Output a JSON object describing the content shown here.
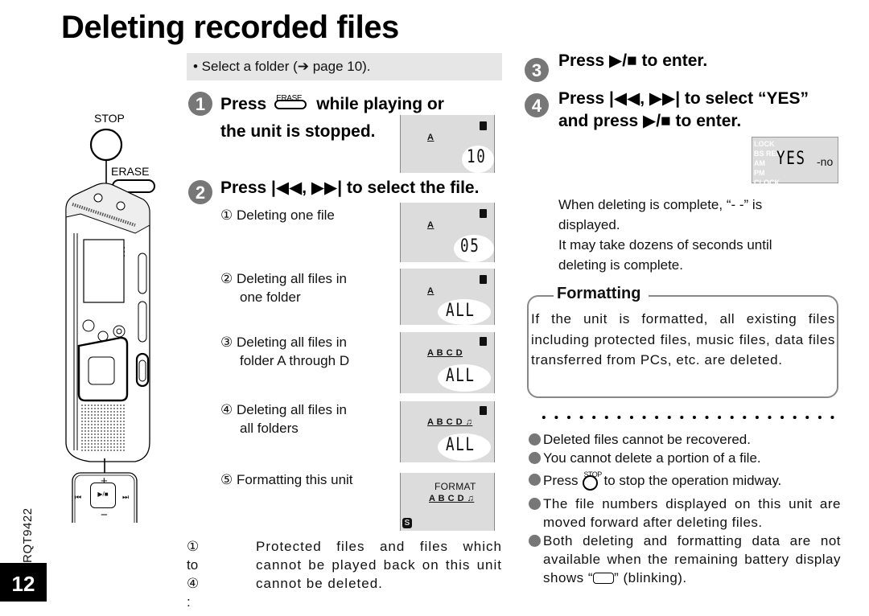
{
  "page": {
    "title": "Deleting recorded files",
    "doc_code": "RQT9422",
    "page_number": "12"
  },
  "prerequisite": "• Select a folder (➔ page 10).",
  "illustration": {
    "stop_label": "STOP",
    "erase_label": "ERASE",
    "pad_plus": "+",
    "pad_minus": "−",
    "pad_center": "▶/■",
    "pad_left": "⏮",
    "pad_right": "⏭"
  },
  "steps": [
    {
      "number": "1",
      "text_before": "Press",
      "button_label": "ERASE",
      "text_after": "while playing or",
      "line2": "the unit is stopped.",
      "lcd": {
        "folders": "A",
        "value": "10"
      }
    },
    {
      "number": "2",
      "text": "Press |◀◀, ▶▶| to select the file.",
      "options": [
        {
          "label": "① Deleting one file",
          "lcd": {
            "folders": "A",
            "value": "05"
          }
        },
        {
          "label": "② Deleting all files in one folder",
          "line1": "② Deleting all files in",
          "line2": "one folder",
          "lcd": {
            "folders": "A",
            "value": "ALL"
          }
        },
        {
          "label": "③ Deleting all files in folder A through D",
          "line1": "③ Deleting all files in",
          "line2": "folder A through D",
          "lcd": {
            "folders": "A B C D",
            "value": "ALL"
          }
        },
        {
          "label": "④ Deleting all files in all folders",
          "line1": "④ Deleting all files in",
          "line2": "all folders",
          "lcd": {
            "folders": "A B C D ♫",
            "value": "ALL"
          }
        },
        {
          "label": "⑤ Formatting this unit",
          "lcd": {
            "folders": "A B C D ♫",
            "value": "FORMAT",
            "badge": "S"
          }
        }
      ]
    },
    {
      "number": "3",
      "text": "Press ▶/■ to enter."
    },
    {
      "number": "4",
      "line1": "Press |◀◀, ▶▶| to select “YES”",
      "line2": "and press ▶/■ to enter.",
      "lcd": {
        "value": "YES",
        "alt": "-no",
        "faded_labels": [
          "LOCK",
          "BS REM",
          "AM",
          "PM",
          "CLOCK"
        ]
      }
    }
  ],
  "footnote": {
    "label": "① to ④ :",
    "text": "Protected files and files which cannot be played back on this unit cannot be deleted."
  },
  "completion_note": {
    "line1": "When deleting is complete, “- -” is",
    "line2": "displayed.",
    "line3": "It may take dozens of seconds until",
    "line4": "deleting is complete."
  },
  "formatting_box": {
    "title": "Formatting",
    "body": "If the unit is formatted, all existing files including protected files, music files, data files transferred from PCs, etc. are deleted."
  },
  "notes": [
    "Deleted files cannot be recovered.",
    "You cannot delete a portion of a file.",
    {
      "before": "Press",
      "icon_label": "STOP",
      "after": "to stop the operation midway."
    },
    "The file numbers displayed on this unit are moved forward after deleting files.",
    {
      "before": "Both deleting and formatting data are not available when the remaining battery display shows “",
      "after": "” (blinking)."
    }
  ],
  "colors": {
    "step_circle": "#777777",
    "lcd_bg": "#dcdcdc",
    "prereq_bg": "#e6e6e6",
    "page_tab": "#000000"
  }
}
